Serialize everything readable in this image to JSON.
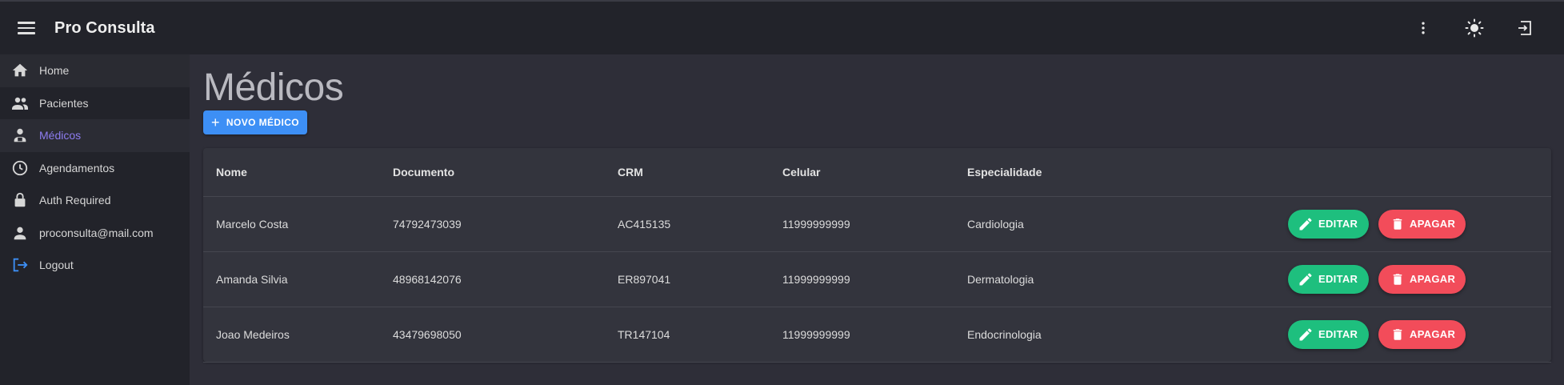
{
  "app": {
    "title": "Pro Consulta"
  },
  "sidebar": {
    "items": [
      {
        "label": "Home",
        "icon": "home-icon"
      },
      {
        "label": "Pacientes",
        "icon": "people-icon"
      },
      {
        "label": "Médicos",
        "icon": "person-badge-icon",
        "active": true
      },
      {
        "label": "Agendamentos",
        "icon": "clock-icon"
      },
      {
        "label": "Auth Required",
        "icon": "lock-icon"
      },
      {
        "label": "proconsulta@mail.com",
        "icon": "person-icon"
      },
      {
        "label": "Logout",
        "icon": "logout-icon"
      }
    ]
  },
  "main": {
    "title": "Médicos",
    "new_button_label": "NOVO MÉDICO",
    "table": {
      "columns": [
        "Nome",
        "Documento",
        "CRM",
        "Celular",
        "Especialidade"
      ],
      "rows": [
        {
          "nome": "Marcelo Costa",
          "documento": "74792473039",
          "crm": "AC415135",
          "celular": "11999999999",
          "especialidade": "Cardiologia"
        },
        {
          "nome": "Amanda Silvia",
          "documento": "48968142076",
          "crm": "ER897041",
          "celular": "11999999999",
          "especialidade": "Dermatologia"
        },
        {
          "nome": "Joao Medeiros",
          "documento": "43479698050",
          "crm": "TR147104",
          "celular": "11999999999",
          "especialidade": "Endocrinologia"
        }
      ],
      "edit_label": "EDITAR",
      "delete_label": "APAGAR"
    }
  },
  "colors": {
    "accent": "#8d7cf0",
    "primary_button": "#3d8ff5",
    "edit_button": "#1ebf7e",
    "delete_button": "#f24c5a"
  }
}
